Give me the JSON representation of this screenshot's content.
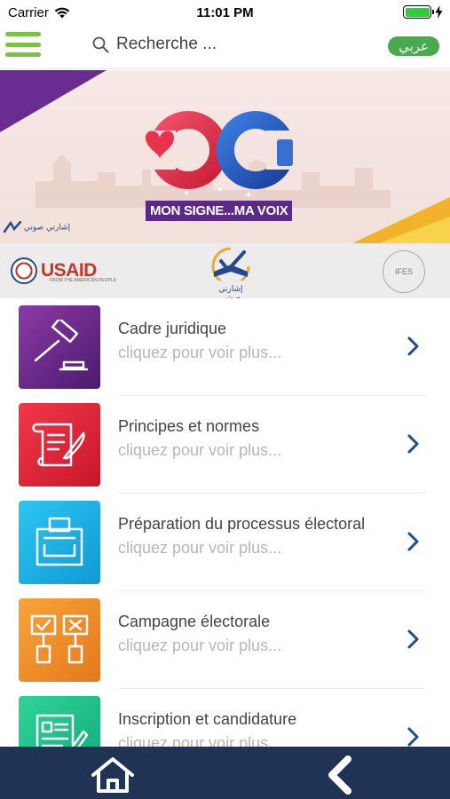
{
  "status_bar": {
    "carrier": "Carrier",
    "time": "11:01 PM",
    "battery_level": 1.0
  },
  "header": {
    "menu_icon": "hamburger-icon",
    "search_placeholder": "Recherche ...",
    "lang_button": "عربي",
    "accent_color": "#7cc242"
  },
  "banner": {
    "slogan": "MON SIGNE...MA VOIX",
    "logo_caption": "إشارتي صوتي"
  },
  "partners": {
    "usaid_name": "USAID",
    "usaid_tagline": "FROM THE AMERICAN PEOPLE",
    "center_logo_caption": "إشارتي صوتي",
    "ifes_name": "IFES"
  },
  "list": {
    "items": [
      {
        "title": "Cadre juridique",
        "subtitle": "cliquez pour voir plus...",
        "icon": "gavel-icon",
        "color": "#6d2a8e"
      },
      {
        "title": "Principes et normes",
        "subtitle": "cliquez pour voir plus...",
        "icon": "scroll-quill-icon",
        "color": "#e52b3b"
      },
      {
        "title": "Préparation du processus électoral",
        "subtitle": "cliquez pour voir plus...",
        "icon": "ballot-box-icon",
        "color": "#1db6e8"
      },
      {
        "title": "Campagne électorale",
        "subtitle": "cliquez pour voir plus...",
        "icon": "protest-signs-icon",
        "color": "#f0962a"
      },
      {
        "title": "Inscription et candidature",
        "subtitle": "cliquez pour voir plus...",
        "icon": "form-pen-icon",
        "color": "#21c08a"
      }
    ]
  },
  "bottom_nav": {
    "home_icon": "home-icon",
    "back_icon": "back-chevron-icon",
    "background": "#1f3355"
  }
}
